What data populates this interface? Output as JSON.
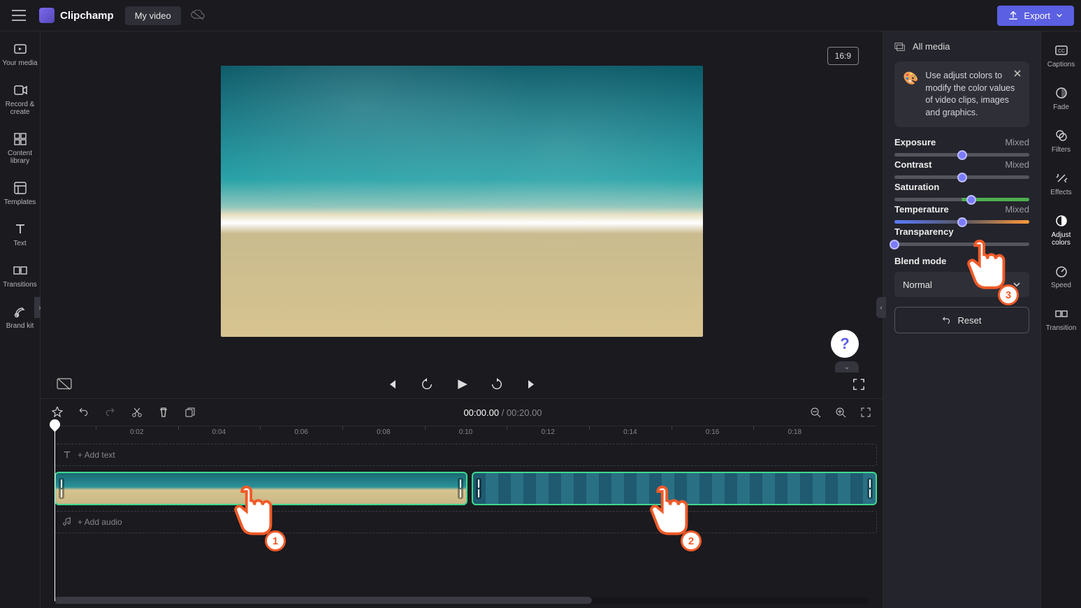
{
  "header": {
    "app_name": "Clipchamp",
    "project_name": "My video",
    "export_label": "Export"
  },
  "left_nav": [
    {
      "id": "your-media",
      "label": "Your media"
    },
    {
      "id": "record-create",
      "label": "Record &\ncreate"
    },
    {
      "id": "content-library",
      "label": "Content\nlibrary"
    },
    {
      "id": "templates",
      "label": "Templates"
    },
    {
      "id": "text",
      "label": "Text"
    },
    {
      "id": "transitions",
      "label": "Transitions"
    },
    {
      "id": "brand-kit",
      "label": "Brand kit"
    }
  ],
  "preview": {
    "aspect_ratio": "16:9"
  },
  "player": {
    "current_time": "00:00.00",
    "total_time": "00:20.00"
  },
  "timeline": {
    "ticks": [
      "0:02",
      "0:04",
      "0:06",
      "0:08",
      "0:10",
      "0:12",
      "0:14",
      "0:16",
      "0:18"
    ],
    "add_text_label": "+ Add text",
    "add_audio_label": "+ Add audio"
  },
  "right_panel": {
    "head": "All media",
    "tip": "Use adjust colors to modify the color values of video clips, images and graphics.",
    "sliders": [
      {
        "name": "Exposure",
        "value": "Mixed",
        "pos": 50,
        "cls": ""
      },
      {
        "name": "Contrast",
        "value": "Mixed",
        "pos": 50,
        "cls": ""
      },
      {
        "name": "Saturation",
        "value": "",
        "pos": 57,
        "cls": "sat"
      },
      {
        "name": "Temperature",
        "value": "Mixed",
        "pos": 50,
        "cls": "temp"
      },
      {
        "name": "Transparency",
        "value": "",
        "pos": 0,
        "cls": ""
      }
    ],
    "blend_mode_label": "Blend mode",
    "blend_mode_value": "Normal",
    "reset_label": "Reset"
  },
  "tool_strip": [
    {
      "id": "captions",
      "label": "Captions"
    },
    {
      "id": "fade",
      "label": "Fade"
    },
    {
      "id": "filters",
      "label": "Filters"
    },
    {
      "id": "effects",
      "label": "Effects"
    },
    {
      "id": "adjust-colors",
      "label": "Adjust\ncolors",
      "active": true
    },
    {
      "id": "speed",
      "label": "Speed"
    },
    {
      "id": "transition",
      "label": "Transition"
    }
  ],
  "hands": [
    {
      "n": "1"
    },
    {
      "n": "2"
    },
    {
      "n": "3"
    }
  ]
}
